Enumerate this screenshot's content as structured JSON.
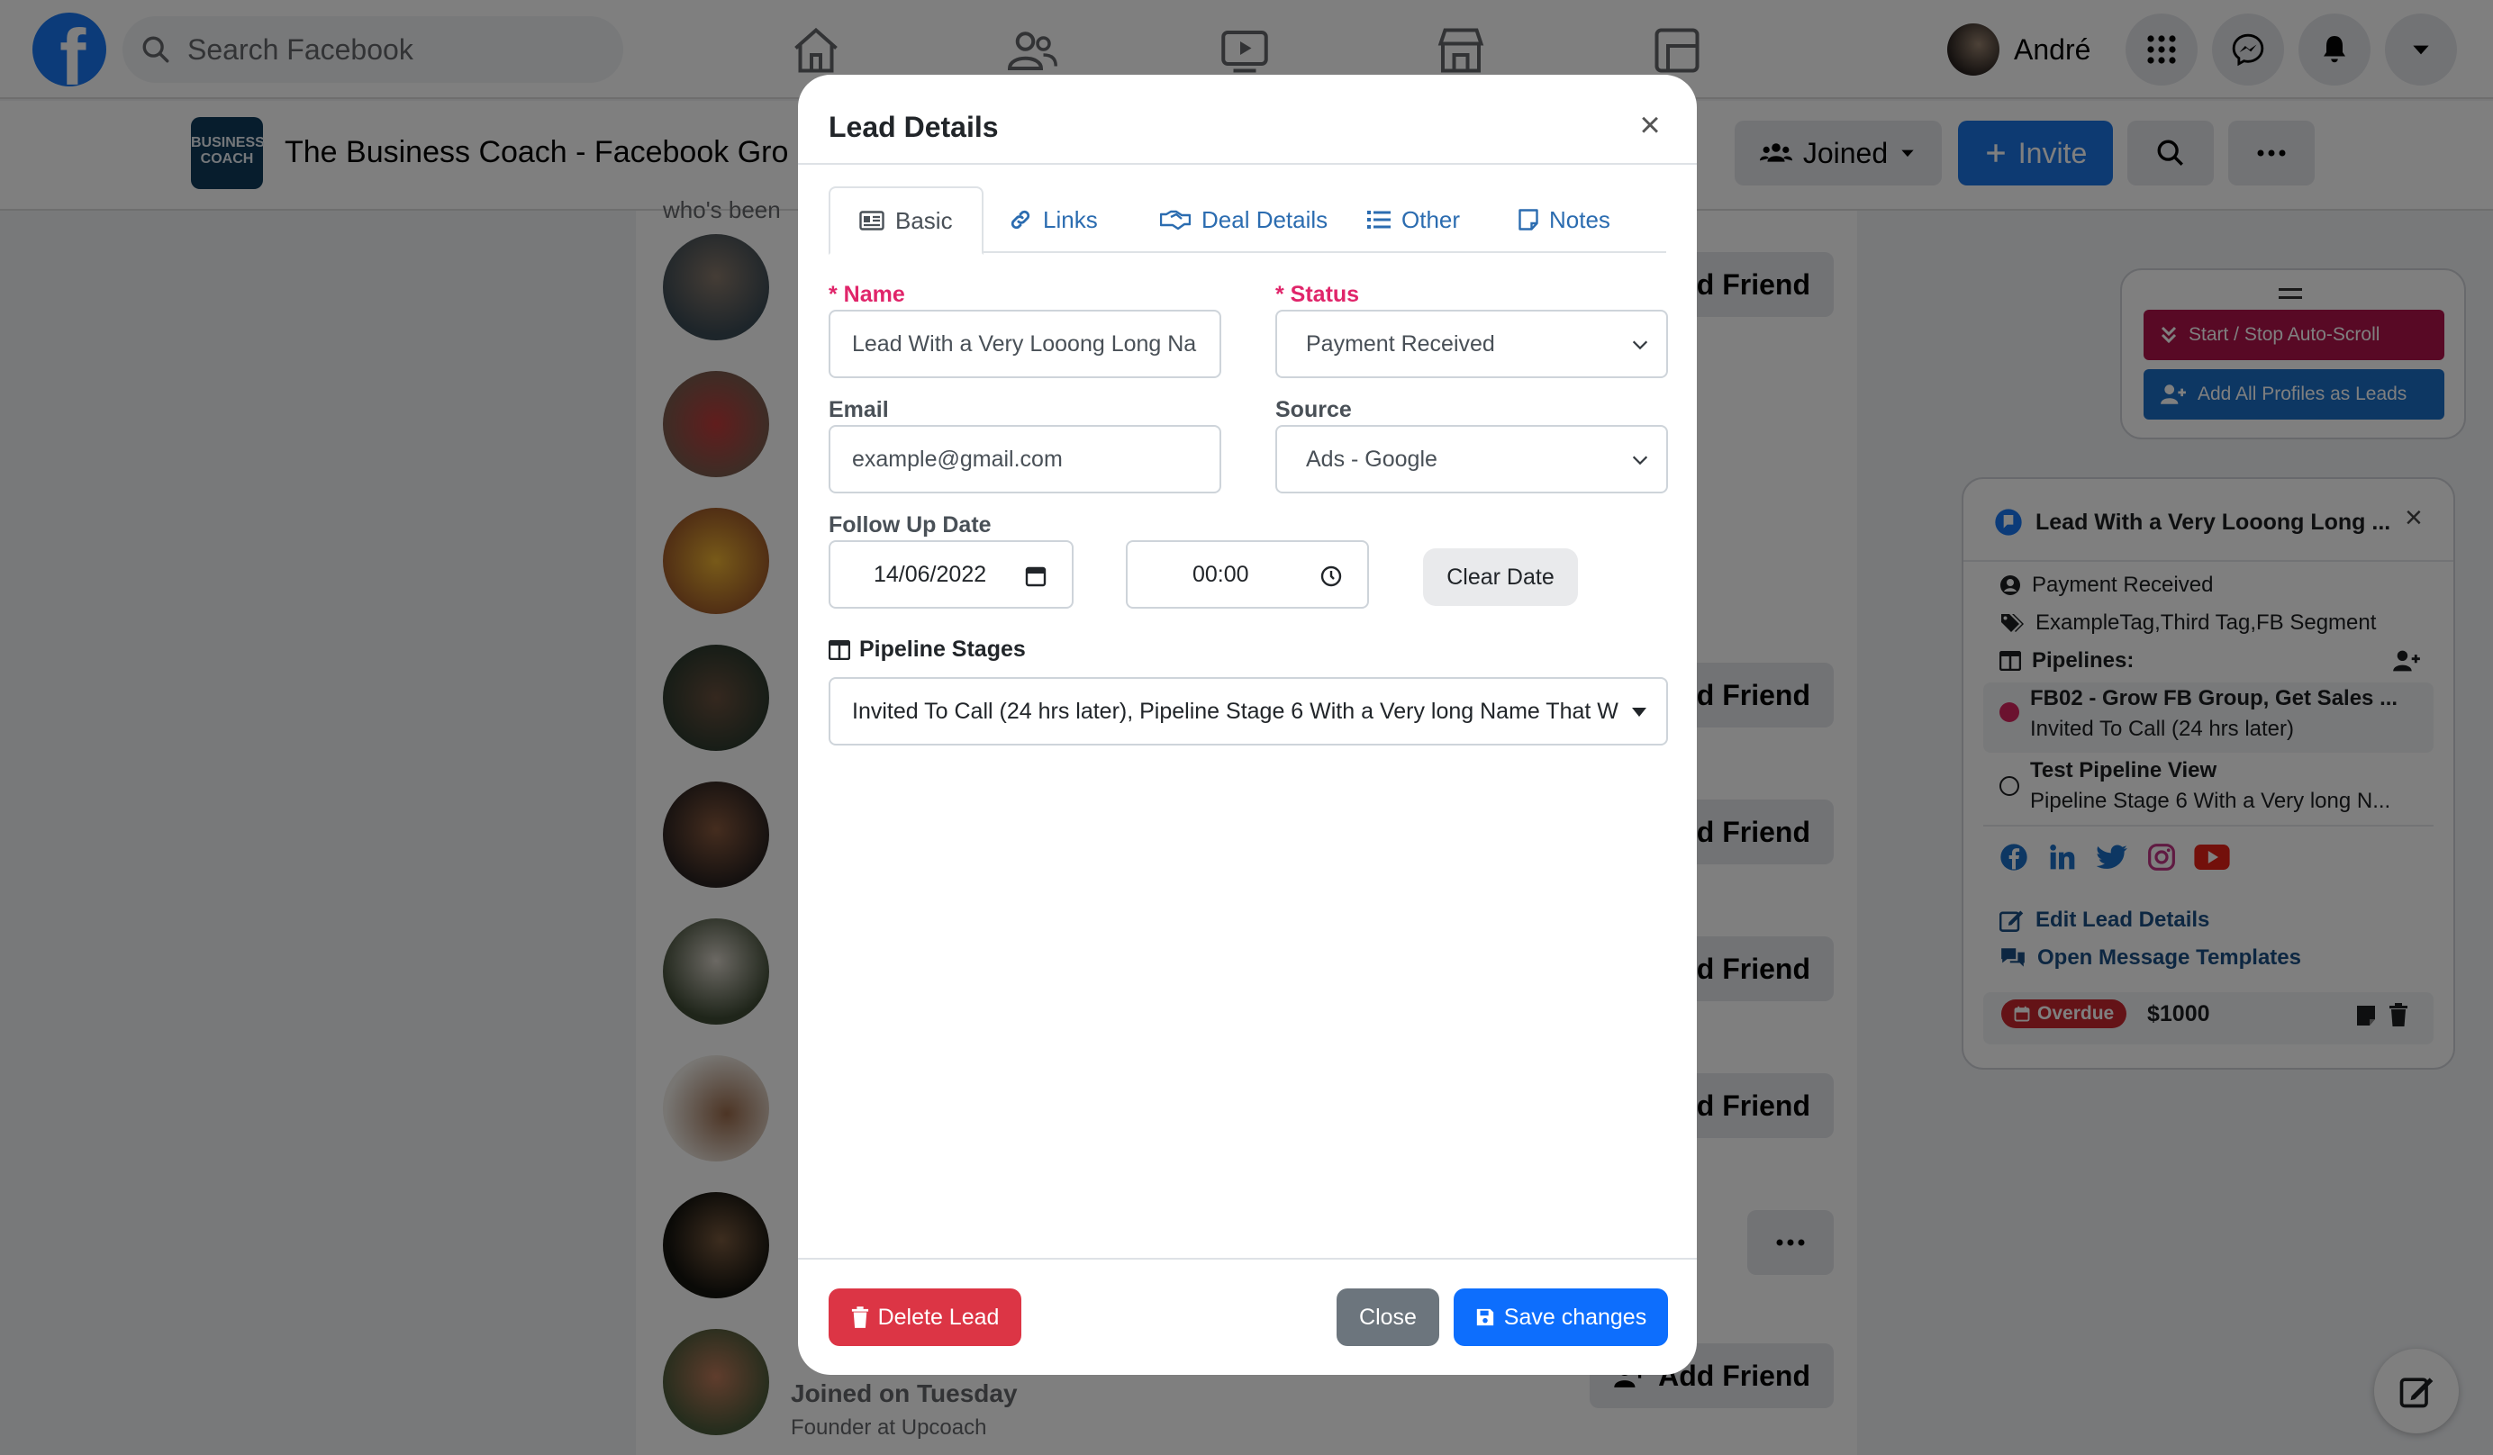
{
  "topbar": {
    "search_placeholder": "Search Facebook",
    "user_name": "André"
  },
  "group": {
    "logo_text": "BUSINESS COACH",
    "title": "The Business Coach - Facebook Gro",
    "joined_label": "Joined",
    "invite_label": "Invite"
  },
  "feed": {
    "clipped_heading": "who's been",
    "add_friend_label": "dd Friend",
    "last_member": {
      "add_friend_label": "Add Friend",
      "joined": "Joined on Tuesday",
      "role": "Founder at Upcoach"
    }
  },
  "bulk_panel": {
    "auto_scroll_label": "Start / Stop Auto-Scroll",
    "add_profiles_label": "Add All Profiles as Leads"
  },
  "lead_panel": {
    "title": "Lead With a Very Looong Long ...",
    "status": "Payment Received",
    "tags": "ExampleTag,Third Tag,FB Segment",
    "pipelines_label": "Pipelines:",
    "pipelines": [
      {
        "name": "FB02 - Grow FB Group, Get Sales ...",
        "stage": "Invited To Call (24 hrs later)",
        "color": "#d6245e",
        "filled": true
      },
      {
        "name": "Test Pipeline View",
        "stage": "Pipeline Stage 6 With a Very long N...",
        "color": "#1c1e21",
        "filled": false
      }
    ],
    "edit_label": "Edit Lead Details",
    "templates_label": "Open Message Templates",
    "overdue_label": "Overdue",
    "deal_value": "$1000"
  },
  "modal": {
    "title": "Lead Details",
    "tabs": [
      {
        "label": "Basic",
        "icon": "id-card-icon"
      },
      {
        "label": "Links",
        "icon": "link-icon"
      },
      {
        "label": "Deal Details",
        "icon": "handshake-icon"
      },
      {
        "label": "Other",
        "icon": "list-icon"
      },
      {
        "label": "Notes",
        "icon": "note-icon"
      }
    ],
    "name_label": "* Name",
    "name_value": "Lead With a Very Looong Long Na",
    "status_label": "* Status",
    "status_value": "Payment Received",
    "email_label": "Email",
    "email_value": "example@gmail.com",
    "source_label": "Source",
    "source_value": "Ads - Google",
    "follow_up_label": "Follow Up Date",
    "date_value": "14/06/2022",
    "time_value": "00:00",
    "clear_date_label": "Clear Date",
    "pipeline_label": "Pipeline Stages",
    "pipeline_value": "Invited To Call (24 hrs later), Pipeline Stage 6 With a Very long Name That W",
    "delete_label": "Delete Lead",
    "close_label": "Close",
    "save_label": "Save changes"
  },
  "colors": {
    "facebook_blue": "#1877f2",
    "required_pink": "#e0256a",
    "danger": "#dc3545",
    "primary": "#0d6efd",
    "secondary": "#6c757d"
  }
}
